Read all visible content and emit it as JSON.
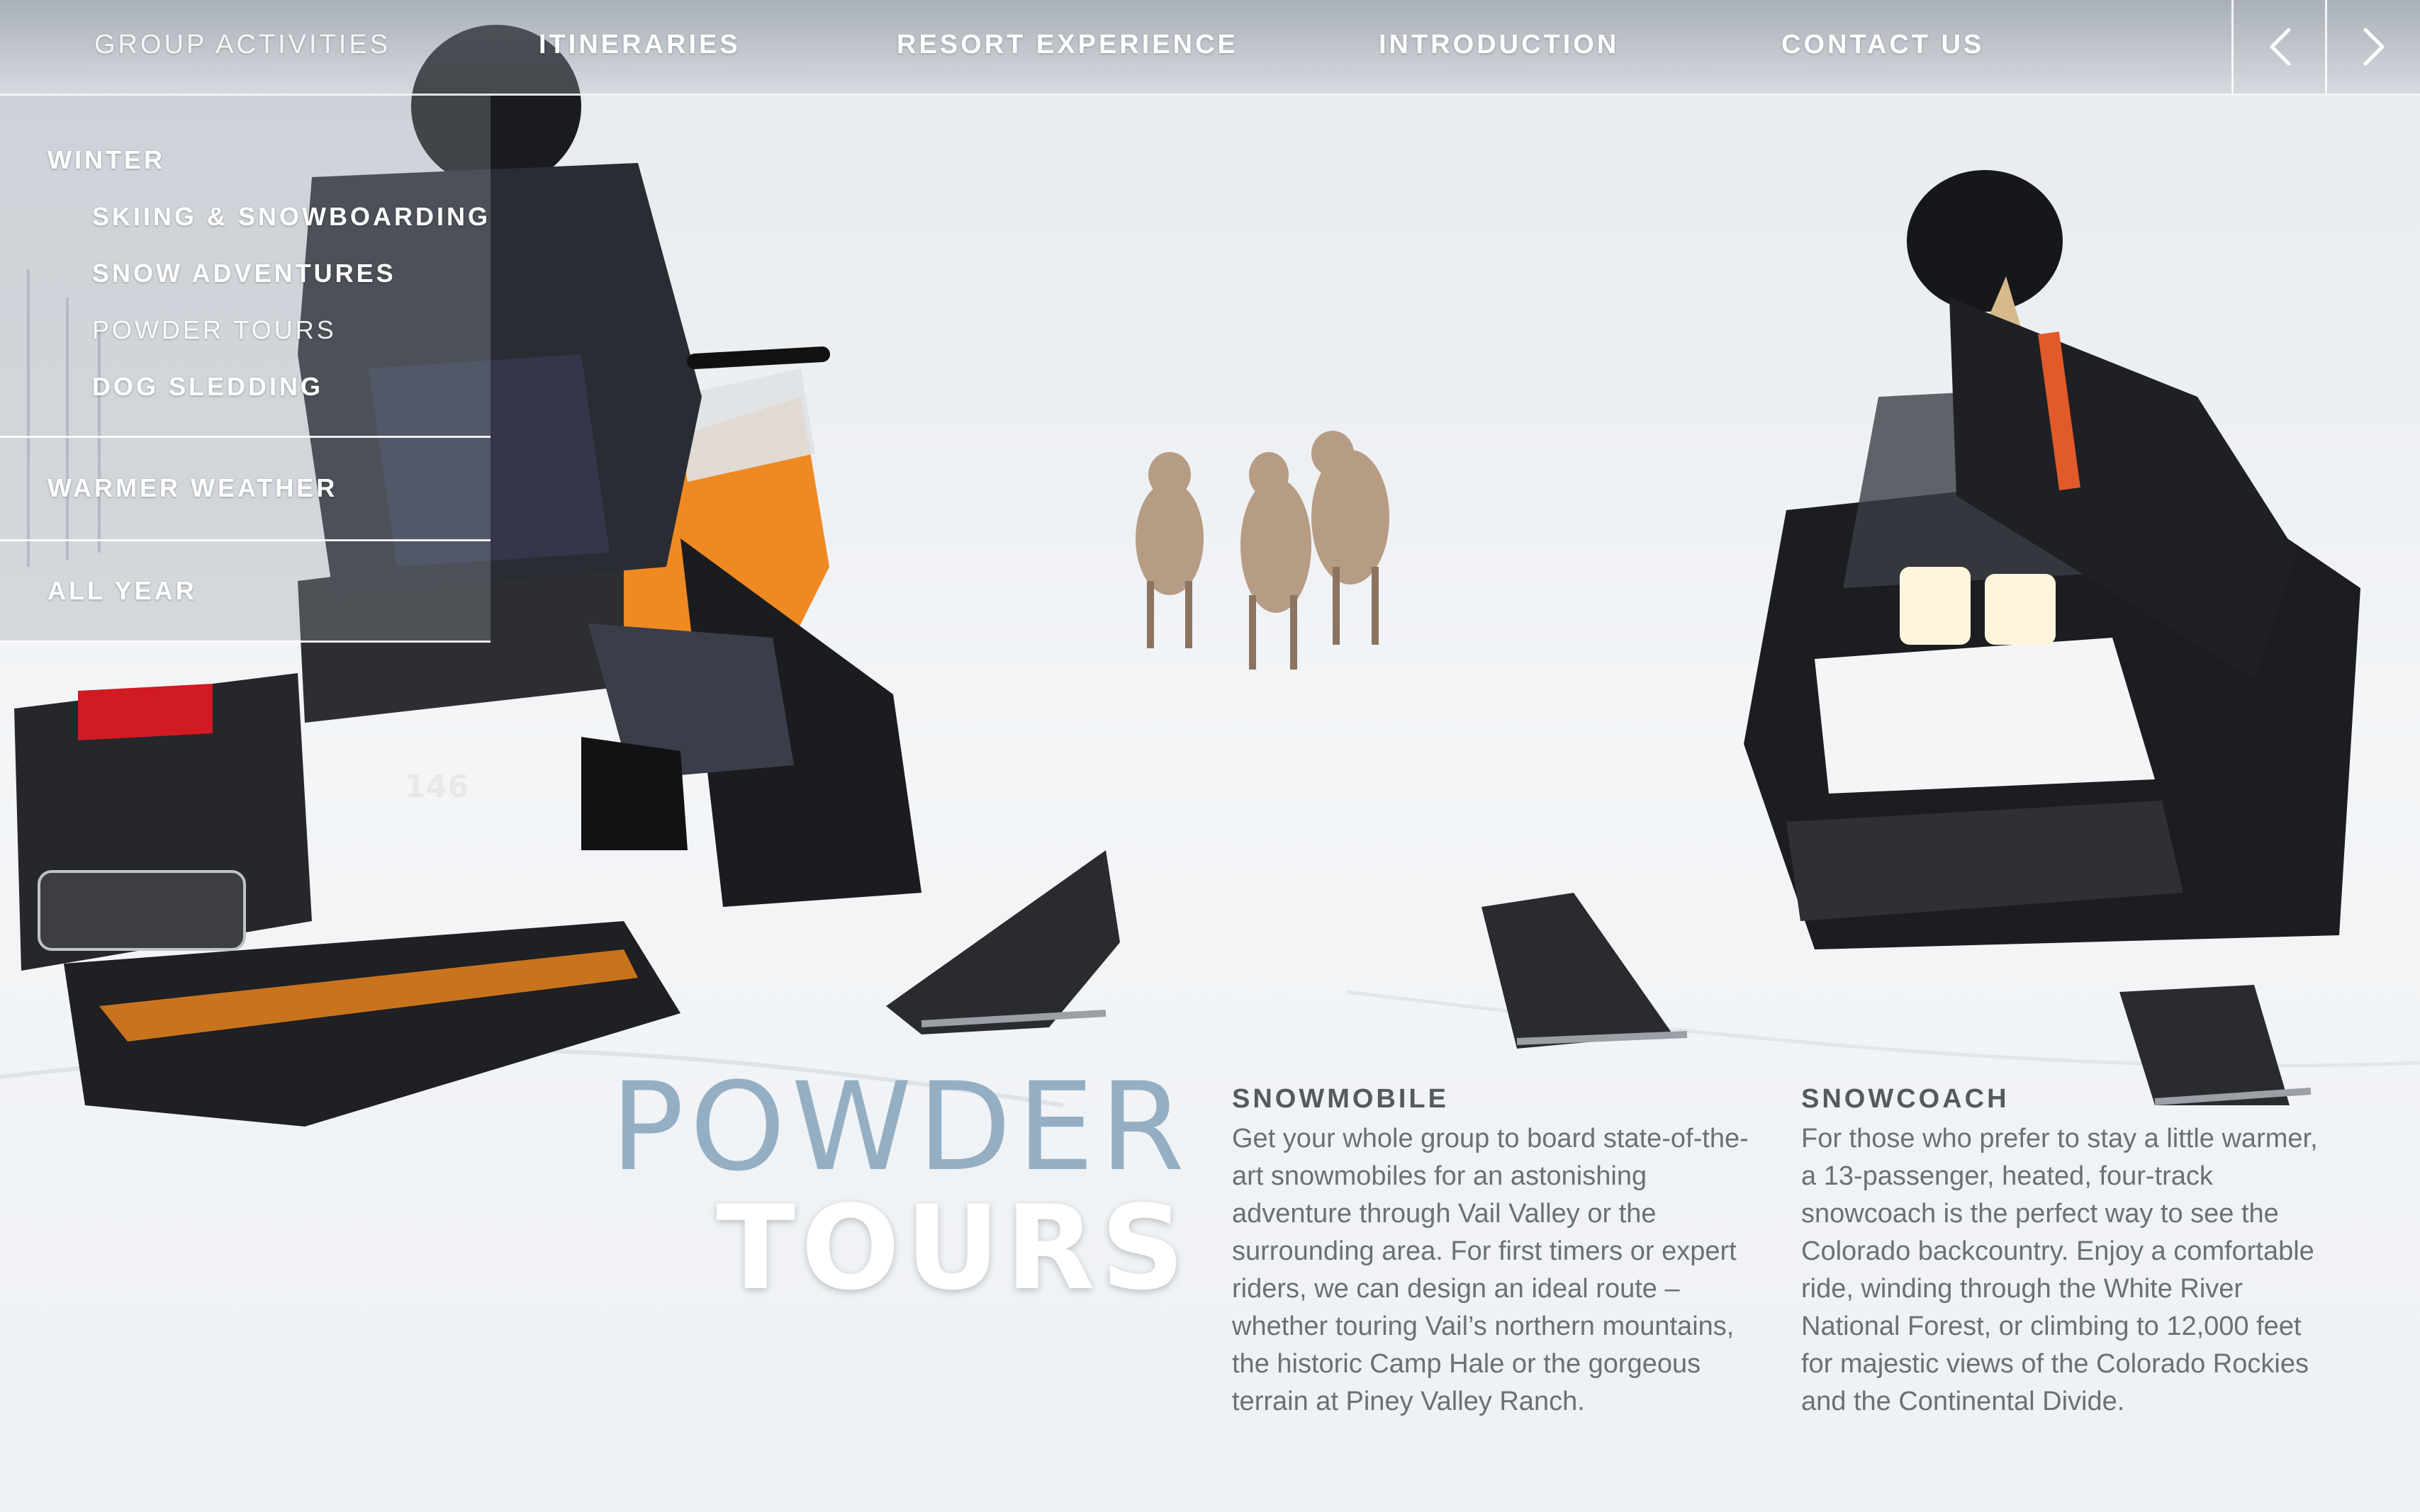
{
  "nav": {
    "items": [
      {
        "label": "GROUP ACTIVITIES"
      },
      {
        "label": "ITINERARIES"
      },
      {
        "label": "RESORT EXPERIENCE"
      },
      {
        "label": "INTRODUCTION"
      },
      {
        "label": "CONTACT US"
      }
    ],
    "prev_icon": "chevron-left-icon",
    "next_icon": "chevron-right-icon"
  },
  "dropdown": {
    "sections": [
      {
        "label": "WINTER",
        "children": [
          {
            "label": "SKIING & SNOWBOARDING"
          },
          {
            "label": "SNOW ADVENTURES"
          },
          {
            "label": "POWDER TOURS"
          },
          {
            "label": "DOG SLEDDING"
          }
        ]
      },
      {
        "label": "WARMER WEATHER"
      },
      {
        "label": "ALL YEAR"
      }
    ]
  },
  "hero": {
    "title_line1": "POWDER",
    "title_line2": "TOURS"
  },
  "columns": [
    {
      "heading": "SNOWMOBILE",
      "body": "Get your whole group to board state-of-the-art snowmobiles for an astonishing adventure through Vail Valley or the surrounding area. For first timers or expert riders, we can design an ideal route – whether touring Vail’s northern mountains, the historic Camp Hale or the gorgeous terrain at Piney Valley Ranch."
    },
    {
      "heading": "SNOWCOACH",
      "body": "For those who prefer to stay a little warmer, a 13-passenger, heated, four-track snowcoach is the perfect way to see the Colorado backcountry. Enjoy a comfortable ride, winding through the White River National Forest, or climbing to 12,000 feet for majestic views of the Colorado Rockies and the Continental Divide."
    }
  ],
  "colors": {
    "snow": "#eef1f4",
    "title_accent": "#94afc4",
    "body_text": "#6b7076",
    "sled_orange": "#e8821e",
    "sled_black": "#1c1d20"
  }
}
